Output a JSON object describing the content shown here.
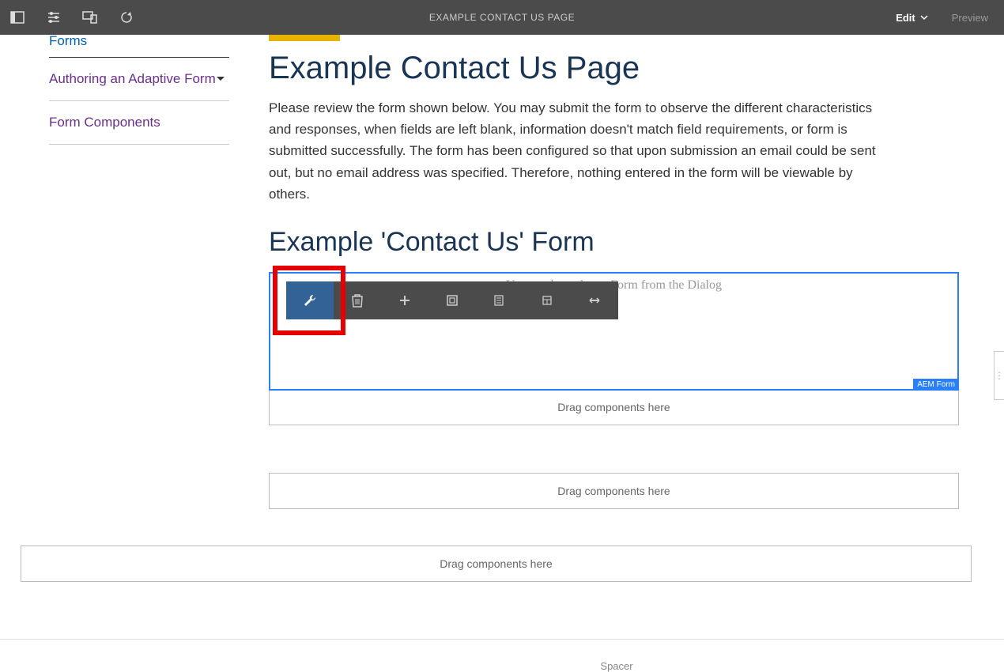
{
  "toolbar": {
    "title": "EXAMPLE CONTACT US PAGE",
    "edit_label": "Edit",
    "preview_label": "Preview"
  },
  "sidebar": {
    "title": "Forms",
    "items": [
      {
        "label": "Authoring an Adaptive Form"
      },
      {
        "label": "Form Components"
      }
    ]
  },
  "main": {
    "heading": "Example Contact Us Page",
    "desc": "Please review the form shown below. You may submit the form to observe the different characteristics and responses, when fields are left blank, information doesn't match field requirements, or form is submitted successfully. The form has been configured so that upon submission an email could be sent out, but no email address was specified. Therefore, nothing entered in the form will be viewable by others.",
    "subheading": "Example 'Contact Us' Form",
    "form_placeholder_text": "You need to select a Form from the Dialog",
    "aem_badge": "AEM Form",
    "drop_label": "Drag components here",
    "footer_label": "Spacer"
  },
  "editor_toolbar": {
    "icons": [
      "wrench-icon",
      "delete-icon",
      "add-icon",
      "group-icon",
      "copy-icon",
      "layout-icon",
      "expand-icon"
    ]
  }
}
